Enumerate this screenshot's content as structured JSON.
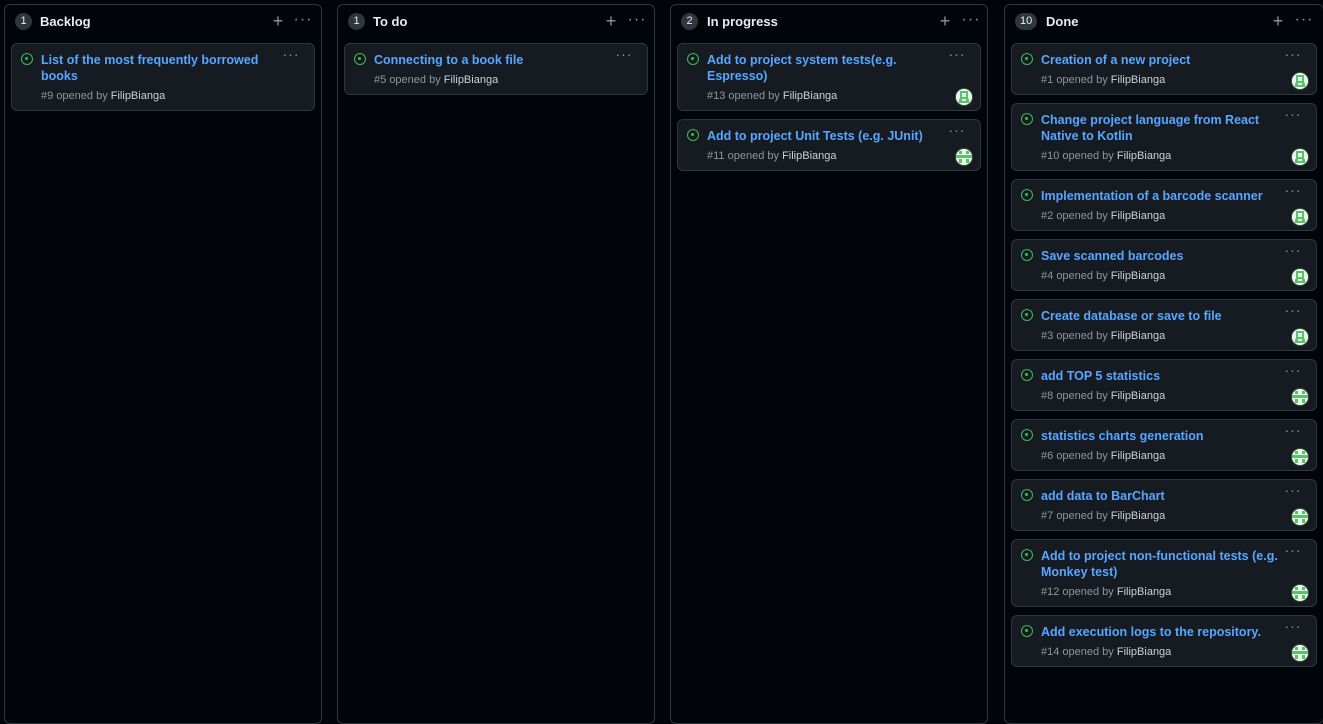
{
  "columns": [
    {
      "count": "1",
      "title": "Backlog",
      "cards": [
        {
          "title_line1": "List of the most frequently borrowed",
          "title_line2": "books",
          "number": "#9",
          "opened_by": "opened by",
          "author": "FilipBianga",
          "avatar": ""
        }
      ]
    },
    {
      "count": "1",
      "title": "To do",
      "cards": [
        {
          "title_line1": "Connecting to a book file",
          "title_line2": "",
          "number": "#5",
          "opened_by": "opened by",
          "author": "FilipBianga",
          "avatar": ""
        }
      ]
    },
    {
      "count": "2",
      "title": "In progress",
      "cards": [
        {
          "title_line1": "Add to project system tests(e.g.",
          "title_line2": "Espresso)",
          "number": "#13",
          "opened_by": "opened by",
          "author": "FilipBianga",
          "avatar": "identicon-green"
        },
        {
          "title_line1": "Add to project Unit Tests (e.g. JUnit)",
          "title_line2": "",
          "number": "#11",
          "opened_by": "opened by",
          "author": "FilipBianga",
          "avatar": "identicon-pattern"
        }
      ]
    },
    {
      "count": "10",
      "title": "Done",
      "cards": [
        {
          "title_line1": "Creation of a new project",
          "title_line2": "",
          "number": "#1",
          "opened_by": "opened by",
          "author": "FilipBianga",
          "avatar": "identicon-green"
        },
        {
          "title_line1": "Change project language from React",
          "title_line2": "Native to Kotlin",
          "number": "#10",
          "opened_by": "opened by",
          "author": "FilipBianga",
          "avatar": "identicon-green"
        },
        {
          "title_line1": "Implementation of a barcode scanner",
          "title_line2": "",
          "number": "#2",
          "opened_by": "opened by",
          "author": "FilipBianga",
          "avatar": "identicon-green"
        },
        {
          "title_line1": "Save scanned barcodes",
          "title_line2": "",
          "number": "#4",
          "opened_by": "opened by",
          "author": "FilipBianga",
          "avatar": "identicon-green"
        },
        {
          "title_line1": "Create database or save to file",
          "title_line2": "",
          "number": "#3",
          "opened_by": "opened by",
          "author": "FilipBianga",
          "avatar": "identicon-green"
        },
        {
          "title_line1": "add TOP 5 statistics",
          "title_line2": "",
          "number": "#8",
          "opened_by": "opened by",
          "author": "FilipBianga",
          "avatar": "identicon-pattern"
        },
        {
          "title_line1": "statistics charts generation",
          "title_line2": "",
          "number": "#6",
          "opened_by": "opened by",
          "author": "FilipBianga",
          "avatar": "identicon-pattern"
        },
        {
          "title_line1": "add data to BarChart",
          "title_line2": "",
          "number": "#7",
          "opened_by": "opened by",
          "author": "FilipBianga",
          "avatar": "identicon-pattern"
        },
        {
          "title_line1": "Add to project non-functional tests (e.g.",
          "title_line2": "Monkey test)",
          "number": "#12",
          "opened_by": "opened by",
          "author": "FilipBianga",
          "avatar": "identicon-pattern"
        },
        {
          "title_line1": "Add execution logs to the repository.",
          "title_line2": "",
          "number": "#14",
          "opened_by": "opened by",
          "author": "FilipBianga",
          "avatar": "identicon-pattern"
        }
      ]
    }
  ],
  "icons": {
    "add": "+",
    "menu": "···",
    "status": "issue-opened-icon"
  },
  "colors": {
    "background": "#010409",
    "card": "#161b22",
    "border": "#30363d",
    "link": "#58a6ff",
    "open_status": "#3fb950",
    "muted": "#8d96a0"
  }
}
